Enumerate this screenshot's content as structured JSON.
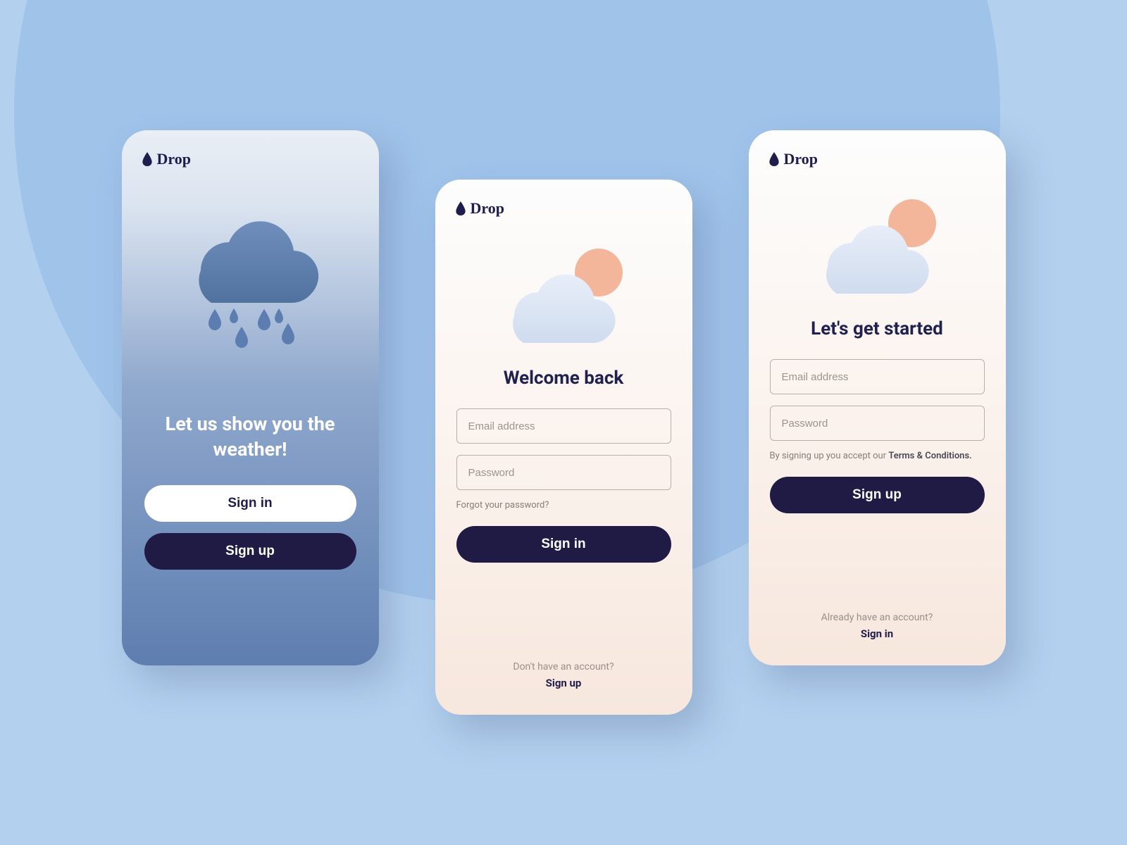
{
  "brand": "Drop",
  "welcome": {
    "headline": "Let us show you the weather!",
    "signin": "Sign in",
    "signup": "Sign up"
  },
  "signin": {
    "title": "Welcome back",
    "email_placeholder": "Email address",
    "password_placeholder": "Password",
    "forgot": "Forgot your password?",
    "submit": "Sign in",
    "alt_prompt": "Don't have an account?",
    "alt_action": "Sign up"
  },
  "signup": {
    "title": "Let's get started",
    "email_placeholder": "Email address",
    "password_placeholder": "Password",
    "terms_prefix": "By signing up you accept  our ",
    "terms_link": "Terms & Conditions.",
    "submit": "Sign up",
    "alt_prompt": "Already have an account?",
    "alt_action": "Sign in"
  }
}
